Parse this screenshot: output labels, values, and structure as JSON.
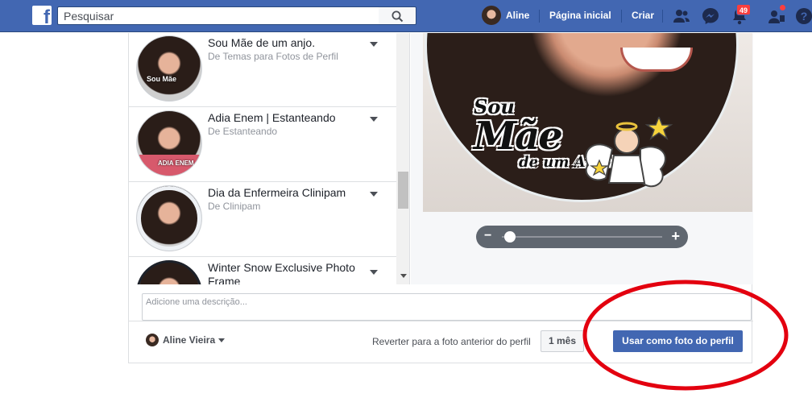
{
  "topbar": {
    "search_placeholder": "Pesquisar",
    "user_name": "Aline",
    "home_label": "Página inicial",
    "create_label": "Criar",
    "notifications_count": "49",
    "icons": [
      "facebook-logo",
      "search-icon",
      "friends-icon",
      "messenger-icon",
      "notifications-icon",
      "account-requests-icon",
      "help-icon"
    ]
  },
  "frames": [
    {
      "title": "Sou Mãe de um anjo.",
      "source": "De Temas para Fotos de Perfil",
      "thumb_tag": "Sou Mãe"
    },
    {
      "title": "Adia Enem | Estanteando",
      "source": "De Estanteando",
      "thumb_tag": "ADIA ENEM"
    },
    {
      "title": "Dia da Enfermeira Clinipam",
      "source": "De Clinipam",
      "thumb_tag": ""
    },
    {
      "title": "Winter Snow Exclusive Photo Frame",
      "source": "",
      "thumb_tag": ""
    }
  ],
  "preview": {
    "sticker_line1": "Sou",
    "sticker_line2": "Mãe",
    "sticker_line3": "de um Anjo!",
    "zoom_minus": "−",
    "zoom_plus": "+",
    "zoom_level": 0.05
  },
  "footer": {
    "description_placeholder": "Adicione uma descrição...",
    "owner_name": "Aline Vieira",
    "revert_label": "Reverter para a foto anterior do perfil",
    "duration_label": "1 mês",
    "use_button_label": "Usar como foto do perfil"
  },
  "colors": {
    "brand_blue": "#4267b2",
    "annotation_red": "#e3000f",
    "notification_red": "#fa3e3e"
  }
}
